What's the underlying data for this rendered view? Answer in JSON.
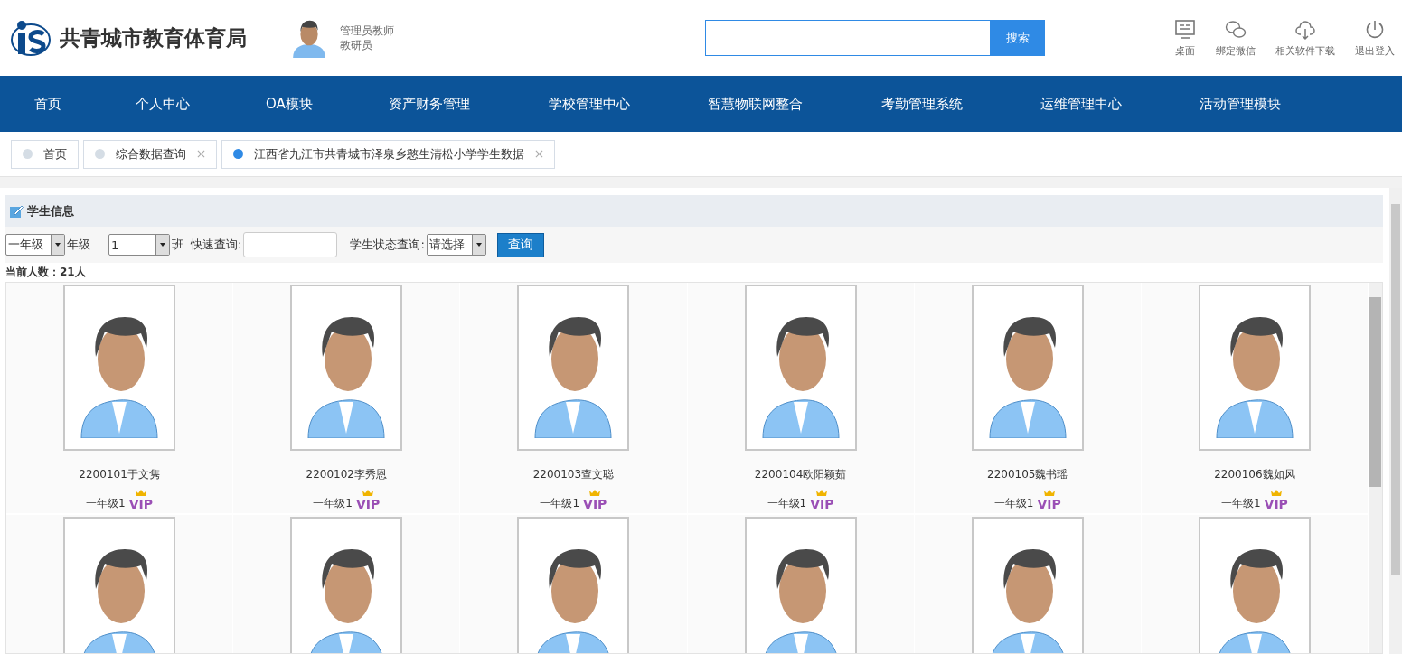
{
  "header": {
    "title": "共青城市教育体育局",
    "user_name": "管理员教师",
    "user_role": "教研员",
    "search_button": "搜索",
    "tools": [
      {
        "kind": "desktop",
        "label": "桌面"
      },
      {
        "kind": "wechat",
        "label": "绑定微信"
      },
      {
        "kind": "download",
        "label": "相关软件下载"
      },
      {
        "kind": "power",
        "label": "退出登入"
      }
    ]
  },
  "nav": [
    "首页",
    "个人中心",
    "OA模块",
    "资产财务管理",
    "学校管理中心",
    "智慧物联网整合",
    "考勤管理系统",
    "运维管理中心",
    "活动管理模块"
  ],
  "tabs": [
    {
      "label": "首页",
      "selected": false,
      "closable": false
    },
    {
      "label": "综合数据查询",
      "selected": false,
      "closable": true
    },
    {
      "label": "江西省九江市共青城市泽泉乡憨生清松小学学生数据",
      "selected": true,
      "closable": true
    }
  ],
  "panel": {
    "title": "学生信息",
    "grade_select": "一年级",
    "grade_label": "年级",
    "class_select": "1",
    "class_label": "班",
    "quick_label": "快速查询:",
    "status_label": "学生状态查询:",
    "status_select": "请选择",
    "query_button": "查询",
    "count": "当前人数：21人"
  },
  "students": [
    {
      "kind": "full",
      "name": "2200101于文隽",
      "class": "一年级1",
      "badge": "VIP"
    },
    {
      "kind": "full",
      "name": "2200102李秀恩",
      "class": "一年级1",
      "badge": "VIP"
    },
    {
      "kind": "full",
      "name": "2200103查文聪",
      "class": "一年级1",
      "badge": "VIP"
    },
    {
      "kind": "full",
      "name": "2200104欧阳颖茹",
      "class": "一年级1",
      "badge": "VIP"
    },
    {
      "kind": "full",
      "name": "2200105魏书瑶",
      "class": "一年级1",
      "badge": "VIP"
    },
    {
      "kind": "full",
      "name": "2200106魏如风",
      "class": "一年级1",
      "badge": "VIP"
    },
    {
      "kind": "photo"
    },
    {
      "kind": "photo"
    },
    {
      "kind": "photo"
    },
    {
      "kind": "photo"
    },
    {
      "kind": "photo"
    },
    {
      "kind": "photo"
    }
  ]
}
